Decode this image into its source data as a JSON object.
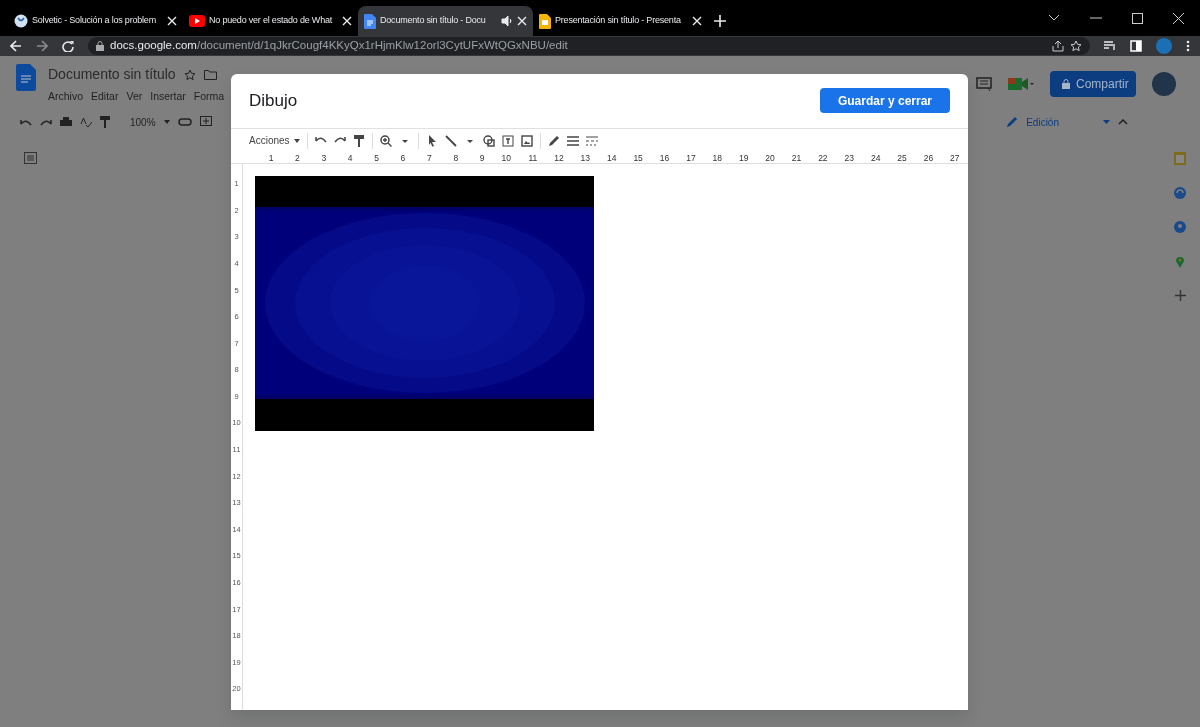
{
  "browser": {
    "tabs": [
      {
        "title": "Solvetic - Solución a los problem",
        "kind": "globe",
        "selected": false,
        "audio": false
      },
      {
        "title": "No puedo ver el estado de What",
        "kind": "video",
        "selected": false,
        "audio": false
      },
      {
        "title": "Documento sin título - Docu",
        "kind": "doc",
        "selected": true,
        "audio": true
      },
      {
        "title": "Presentación sin título - Presenta",
        "kind": "slides",
        "selected": false,
        "audio": false
      }
    ],
    "address": {
      "host": "docs.google.com",
      "path": "/document/d/1qJkrCougf4KKyQx1rHjmKlw12orl3CytUFxWtQGxNBU/edit"
    }
  },
  "document": {
    "title": "Documento sin título",
    "menu": [
      "Archivo",
      "Editar",
      "Ver",
      "Insertar",
      "Forma"
    ],
    "zoom": "100%",
    "share_button": "Compartir",
    "mode": "Edición"
  },
  "dialog": {
    "title": "Dibujo",
    "save_button": "Guardar y cerrar",
    "actions_menu": "Acciones",
    "ruler_horizontal": [
      "1",
      "2",
      "3",
      "4",
      "5",
      "6",
      "7",
      "8",
      "9",
      "10",
      "11",
      "12",
      "13",
      "14",
      "15",
      "16",
      "17",
      "18",
      "19",
      "20",
      "21",
      "22",
      "23",
      "24",
      "25",
      "26",
      "27"
    ],
    "ruler_vertical": [
      "1",
      "2",
      "3",
      "4",
      "5",
      "6",
      "7",
      "8",
      "9",
      "10",
      "11",
      "12",
      "13",
      "14",
      "15",
      "16",
      "17",
      "18",
      "19",
      "20"
    ]
  }
}
